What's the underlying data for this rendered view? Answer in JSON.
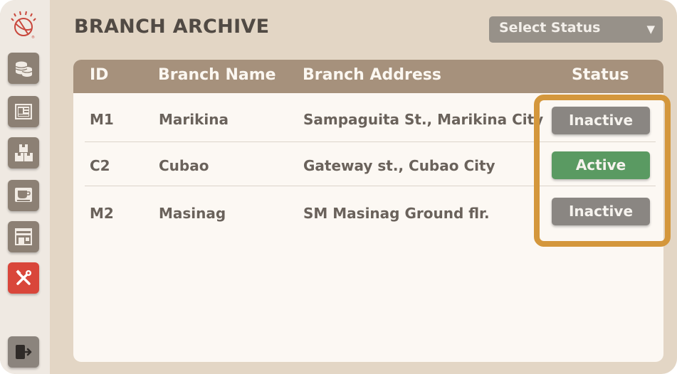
{
  "page": {
    "title": "BRANCH ARCHIVE",
    "filter": {
      "label": "Select Status",
      "arrow": "▼"
    }
  },
  "sidebar": {
    "logo": "logo-icon",
    "items": [
      {
        "icon": "coins-icon",
        "active": false
      },
      {
        "icon": "id-card-icon",
        "active": false
      },
      {
        "icon": "boxes-icon",
        "active": false
      },
      {
        "icon": "coffee-cup-icon",
        "active": false
      },
      {
        "icon": "store-icon",
        "active": false
      },
      {
        "icon": "tools-icon",
        "active": true
      }
    ],
    "logout": {
      "icon": "logout-icon"
    }
  },
  "table": {
    "headers": [
      "ID",
      "Branch Name",
      "Branch Address",
      "Status"
    ],
    "rows": [
      {
        "id": "M1",
        "name": "Marikina",
        "address": "Sampaguita St., Marikina City",
        "status": "Inactive"
      },
      {
        "id": "C2",
        "name": "Cubao",
        "address": "Gateway st., Cubao City",
        "status": "Active"
      },
      {
        "id": "M2",
        "name": "Masinag",
        "address": "SM Masinag Ground flr.",
        "status": "Inactive"
      }
    ]
  },
  "colors": {
    "background": "#e3d6c5",
    "header": "#a6917c",
    "active_status": "#5a9a62",
    "inactive_status": "#8a8682",
    "highlight": "#d4973c",
    "nav_active": "#d9463a"
  }
}
